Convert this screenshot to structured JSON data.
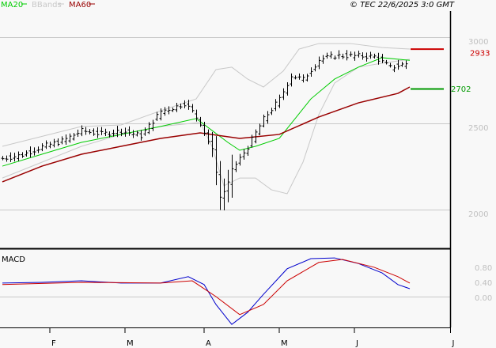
{
  "legend": {
    "ma20": "MA20",
    "bbands": "BBands",
    "ma60": "MA60",
    "copyright": "© TEC 22/6/2025 3:0 GMT"
  },
  "colors": {
    "ma20": "#00cc00",
    "bbands": "#c8c8c8",
    "ma60": "#990000",
    "macd": "#0000cc",
    "signal": "#cc0000",
    "resistance": "#cc0000",
    "support": "#009900"
  },
  "chart_data": [
    {
      "type": "line",
      "title": "Price (OHLC bars) with MA20, MA60, Bollinger Bands",
      "x_unit": "trading day index",
      "ylim": [
        1900,
        3100
      ],
      "y_ticks": [
        {
          "value": 3000,
          "label": "3000"
        },
        {
          "value": 2500,
          "label": "2500"
        },
        {
          "value": 2000,
          "label": "2000"
        }
      ],
      "x_ticks": [
        {
          "day": 12,
          "label": "F"
        },
        {
          "day": 31,
          "label": "M"
        },
        {
          "day": 51,
          "label": "A"
        },
        {
          "day": 70,
          "label": "M"
        },
        {
          "day": 89,
          "label": "J"
        },
        {
          "day": 113,
          "label": "J"
        }
      ],
      "close_anchors": [
        [
          0,
          2298
        ],
        [
          5,
          2320
        ],
        [
          10,
          2367
        ],
        [
          15,
          2400
        ],
        [
          20,
          2459
        ],
        [
          25,
          2440
        ],
        [
          30,
          2459
        ],
        [
          35,
          2430
        ],
        [
          40,
          2573
        ],
        [
          44,
          2600
        ],
        [
          46,
          2619
        ],
        [
          48,
          2570
        ],
        [
          50,
          2505
        ],
        [
          53,
          2344
        ],
        [
          55,
          2069
        ],
        [
          57,
          2150
        ],
        [
          58,
          2229
        ],
        [
          62,
          2367
        ],
        [
          66,
          2527
        ],
        [
          70,
          2642
        ],
        [
          73,
          2780
        ],
        [
          76,
          2757
        ],
        [
          80,
          2872
        ],
        [
          84,
          2894
        ],
        [
          88,
          2894
        ],
        [
          94,
          2890
        ],
        [
          98,
          2826
        ],
        [
          102,
          2849
        ]
      ],
      "series": [
        {
          "name": "MA20",
          "points": [
            [
              0,
              2252
            ],
            [
              10,
              2321
            ],
            [
              20,
              2390
            ],
            [
              30,
              2436
            ],
            [
              40,
              2482
            ],
            [
              49,
              2528
            ],
            [
              53,
              2459
            ],
            [
              57,
              2390
            ],
            [
              60,
              2344
            ],
            [
              64,
              2367
            ],
            [
              70,
              2413
            ],
            [
              74,
              2527
            ],
            [
              78,
              2642
            ],
            [
              84,
              2757
            ],
            [
              90,
              2826
            ],
            [
              96,
              2881
            ],
            [
              100,
              2872
            ],
            [
              103,
              2866
            ]
          ]
        },
        {
          "name": "MA60",
          "points": [
            [
              0,
              2161
            ],
            [
              10,
              2252
            ],
            [
              20,
              2321
            ],
            [
              30,
              2367
            ],
            [
              40,
              2413
            ],
            [
              50,
              2445
            ],
            [
              60,
              2413
            ],
            [
              70,
              2436
            ],
            [
              80,
              2537
            ],
            [
              90,
              2619
            ],
            [
              100,
              2674
            ],
            [
              103,
              2711
            ]
          ]
        },
        {
          "name": "BBands upper",
          "points": [
            [
              0,
              2367
            ],
            [
              20,
              2482
            ],
            [
              30,
              2491
            ],
            [
              40,
              2573
            ],
            [
              49,
              2642
            ],
            [
              54,
              2812
            ],
            [
              58,
              2826
            ],
            [
              62,
              2757
            ],
            [
              66,
              2711
            ],
            [
              71,
              2803
            ],
            [
              75,
              2931
            ],
            [
              80,
              2963
            ],
            [
              88,
              2963
            ],
            [
              96,
              2940
            ],
            [
              103,
              2931
            ]
          ]
        },
        {
          "name": "BBands lower",
          "points": [
            [
              0,
              2183
            ],
            [
              20,
              2367
            ],
            [
              30,
              2436
            ],
            [
              40,
              2482
            ],
            [
              50,
              2505
            ],
            [
              53,
              2367
            ],
            [
              56,
              2138
            ],
            [
              60,
              2183
            ],
            [
              64,
              2183
            ],
            [
              68,
              2115
            ],
            [
              72,
              2092
            ],
            [
              76,
              2275
            ],
            [
              80,
              2551
            ],
            [
              84,
              2734
            ],
            [
              90,
              2826
            ],
            [
              96,
              2849
            ],
            [
              103,
              2872
            ]
          ]
        }
      ],
      "levels": [
        {
          "name": "resistance",
          "value": 2933,
          "label": "2933"
        },
        {
          "name": "support",
          "value": 2702,
          "label": "2702"
        }
      ]
    },
    {
      "type": "line",
      "title": "MACD",
      "ylim": [
        -0.95,
        1.25
      ],
      "y_ticks": [
        {
          "value": 0.8,
          "label": "0.80"
        },
        {
          "value": 0.4,
          "label": "0.40"
        },
        {
          "value": 0.0,
          "label": "0.00"
        }
      ],
      "series": [
        {
          "name": "MACD",
          "points": [
            [
              0,
              0.36
            ],
            [
              10,
              0.38
            ],
            [
              20,
              0.42
            ],
            [
              30,
              0.36
            ],
            [
              40,
              0.36
            ],
            [
              47,
              0.53
            ],
            [
              51,
              0.32
            ],
            [
              54,
              -0.21
            ],
            [
              58,
              -0.74
            ],
            [
              62,
              -0.42
            ],
            [
              66,
              0.06
            ],
            [
              72,
              0.74
            ],
            [
              78,
              1.01
            ],
            [
              84,
              1.03
            ],
            [
              90,
              0.88
            ],
            [
              96,
              0.63
            ],
            [
              100,
              0.32
            ],
            [
              103,
              0.21
            ]
          ]
        },
        {
          "name": "Signal",
          "points": [
            [
              0,
              0.32
            ],
            [
              20,
              0.38
            ],
            [
              40,
              0.36
            ],
            [
              48,
              0.42
            ],
            [
              54,
              0.0
            ],
            [
              60,
              -0.48
            ],
            [
              66,
              -0.21
            ],
            [
              72,
              0.42
            ],
            [
              80,
              0.91
            ],
            [
              86,
              0.99
            ],
            [
              94,
              0.78
            ],
            [
              100,
              0.53
            ],
            [
              103,
              0.36
            ]
          ]
        }
      ]
    }
  ]
}
